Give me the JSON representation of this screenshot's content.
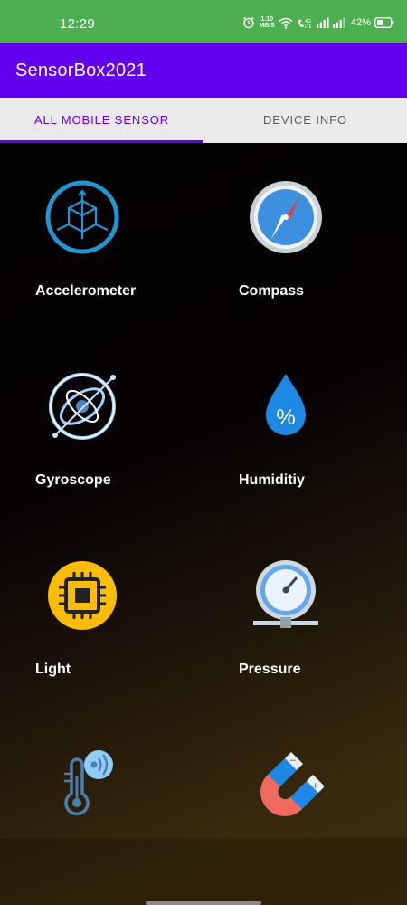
{
  "status_bar": {
    "time": "12:29",
    "net_speed_value": "1.10",
    "net_speed_unit": "MB/S",
    "battery_percent": "42%",
    "icons": [
      "alarm-icon",
      "wifi-icon",
      "volte-icon",
      "signal-icon",
      "battery-icon"
    ]
  },
  "app_bar": {
    "title": "SensorBox2021"
  },
  "tabs": [
    {
      "label": "ALL MOBILE SENSOR",
      "selected": true
    },
    {
      "label": "DEVICE INFO",
      "selected": false
    }
  ],
  "sensors": [
    {
      "label": "Accelerometer",
      "icon": "accelerometer-icon"
    },
    {
      "label": "Compass",
      "icon": "compass-icon"
    },
    {
      "label": "Gyroscope",
      "icon": "gyroscope-icon"
    },
    {
      "label": "Humiditiy",
      "icon": "humidity-icon"
    },
    {
      "label": "Light",
      "icon": "light-icon"
    },
    {
      "label": "Pressure",
      "icon": "pressure-icon"
    },
    {
      "label": "",
      "icon": "temperature-icon"
    },
    {
      "label": "",
      "icon": "magnetometer-icon"
    }
  ],
  "colors": {
    "status_bar": "#4caf50",
    "app_bar": "#6200ee",
    "tab_selected": "#6200ee",
    "tab_unselected": "#5a5a5a",
    "tab_background": "#eaeaea"
  },
  "humidity_symbol": "%"
}
